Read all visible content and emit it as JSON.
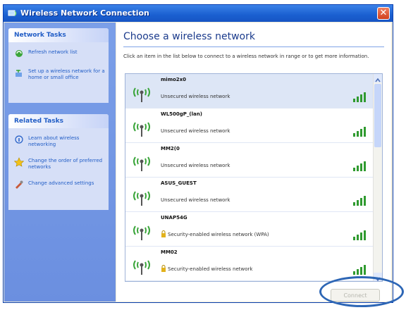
{
  "window": {
    "title": "Wireless Network Connection"
  },
  "sidebar": {
    "network_tasks": {
      "heading": "Network Tasks",
      "items": [
        {
          "label": "Refresh network list",
          "icon": "refresh-icon"
        },
        {
          "label": "Set up a wireless network for a home or small office",
          "icon": "setup-network-icon"
        }
      ]
    },
    "related_tasks": {
      "heading": "Related Tasks",
      "items": [
        {
          "label": "Learn about wireless networking",
          "icon": "info-icon"
        },
        {
          "label": "Change the order of preferred networks",
          "icon": "star-icon"
        },
        {
          "label": "Change advanced settings",
          "icon": "settings-icon"
        }
      ]
    }
  },
  "main": {
    "title": "Choose a wireless network",
    "instructions": "Click an item in the list below to connect to a wireless network in range or to get more information.",
    "networks": [
      {
        "ssid": "mimo2x0",
        "security": "Unsecured wireless network",
        "secured": false,
        "signal_bars": 4
      },
      {
        "ssid": "WL500gP_(lan)",
        "security": "Unsecured wireless network",
        "secured": false,
        "signal_bars": 4
      },
      {
        "ssid": "MM2(0",
        "security": "Unsecured wireless network",
        "secured": false,
        "signal_bars": 4
      },
      {
        "ssid": "ASUS_GUEST",
        "security": "Unsecured wireless network",
        "secured": false,
        "signal_bars": 4
      },
      {
        "ssid": "UNAP54G",
        "security": "Security-enabled wireless network (WPA)",
        "secured": true,
        "signal_bars": 4
      },
      {
        "ssid": "MM02",
        "security": "Security-enabled wireless network",
        "secured": true,
        "signal_bars": 4
      }
    ],
    "connect_label": "Connect"
  },
  "colors": {
    "titlebar": "#1a5fd0",
    "sidebar": "#6b8fe0",
    "link": "#215dc6",
    "ring": "#2d66b5"
  }
}
